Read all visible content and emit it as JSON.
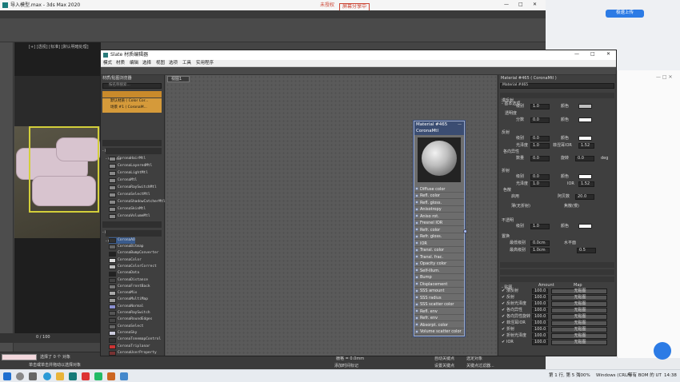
{
  "max": {
    "title": "导入模型.max - 3ds Max 2020",
    "title_center": "未授权",
    "recording": "屏幕分享中",
    "menu": [
      "文件(F)",
      "编辑(E)",
      "工具(T)",
      "组(G)",
      "视图(V)",
      "创建(C)",
      "修改器(M)",
      "动画(A)",
      "图形编辑器(D)",
      "渲染(R)",
      "Civil View",
      "自定义(U)",
      "脚本(S)",
      "Interactive",
      "内容"
    ],
    "search_placeholder": "登录",
    "workspace": "工作区:",
    "view_select": "视图",
    "viewport_label": "[+] [透视] [标准] [默认明暗处理]",
    "time_label": "0 / 100",
    "status_left": "选择了 0 个 对象",
    "status_hint": "单击或单击并拖动以选择对象",
    "coord_x": "X: 0.0mm",
    "coord_y": "Y: 0.0mm",
    "coord_z": "Z: 0.0mm",
    "grid": "栅格 = 0.0mm",
    "auto_key": "自动关键点",
    "set_key": "设置关键点",
    "select_obj": "选定对象",
    "filter": "关键点过滤器...",
    "add_time": "添加时间标记"
  },
  "slate": {
    "title": "Slate 材质编辑器",
    "menu": [
      "模式",
      "材质",
      "编辑",
      "选择",
      "视图",
      "选项",
      "工具",
      "实用程序"
    ],
    "browser_title": "材质/贴图浏览器",
    "browser_search": "按名称搜索...",
    "sample_header": "- 示例窗插槽",
    "view_tab": "视图1",
    "scene_entries": [
      "默认材质 ( Color Cor...",
      "场景 #1 ( CoronaM..."
    ],
    "materials_header": "- Materials",
    "corona_header": "- Corona",
    "materials": [
      "CoronaHairMtl",
      "CoronaLayeredMtl",
      "CoronaLightMtl",
      "CoronaMtl",
      "CoronaRaySwitchMtl",
      "CoronaSelectMtl",
      "CoronaShadowCatcherMtl",
      "CoronaSkinMtl",
      "CoronaVolumeMtl"
    ],
    "maps_header": "- Maps",
    "maps_corona_header": "- Corona",
    "maps": [
      "CoronaAO",
      "CoronaBitmap",
      "CoronaBumpConverter",
      "CoronaColor",
      "CoronaColorCorrect",
      "CoronaData",
      "CoronaDistance",
      "CoronaFrontBack",
      "CoronaMix",
      "CoronaMultiMap",
      "CoronaNormal",
      "CoronaRaySwitch",
      "CoronaRoundEdges",
      "CoronaSelect",
      "CoronaSky",
      "CoronaTonemapControl",
      "CoronaTriplanar",
      "CoronaUserProperty",
      "CoronaWireAndHatch"
    ],
    "status_text": "已完成渲染",
    "zoom": "100%"
  },
  "node": {
    "title": "Material #465",
    "subtitle": "CoronaMtl",
    "slots": [
      "Diffuse color",
      "Refl. color",
      "Refl. gloss.",
      "Anisotropy",
      "Aniso rot.",
      "Fresnel IOR",
      "Refr. color",
      "Refr. gloss.",
      "IOR",
      "Transl. color",
      "Transl. frac.",
      "Opacity color",
      "Self-illum.",
      "Bump",
      "Displacement",
      "SSS amount",
      "SSS radius",
      "SSS scatter color",
      "Refl. env",
      "Refr. env",
      "Absorpt. color",
      "Volume scatter color"
    ]
  },
  "params": {
    "title": "Material #465 ( CoronaMtl )",
    "name_field": "Material #465",
    "basic_header": "- 基本选项",
    "diffuse": {
      "label": "漫反射",
      "level": "级别",
      "level_val": "1.0",
      "color": "颜色",
      "translucency": "透明度",
      "fraction": "分数",
      "fraction_val": "0.0"
    },
    "reflection": {
      "label": "反射",
      "level": "级别",
      "level_val": "0.0",
      "color": "颜色",
      "gloss": "光泽度",
      "gloss_val": "1.0",
      "fresnel": "菲涅耳IOR",
      "fresnel_val": "1.52",
      "aniso": "各向异性",
      "amount": "数量",
      "amount_val": "0.0",
      "rotation": "旋转",
      "rotation_val": "0.0",
      "deg": "deg"
    },
    "refraction": {
      "label": "折射",
      "level": "级别",
      "level_val": "0.0",
      "color": "颜色",
      "gloss": "光泽度",
      "gloss_val": "1.0",
      "ior": "IOR",
      "ior_val": "1.52",
      "dispersion": "色散",
      "enable": "启用",
      "abbe": "阿贝数",
      "abbe_val": "20.0",
      "thin": "薄(无折射)",
      "caustics": "焦散(慢)"
    },
    "opacity": {
      "label": "不透明",
      "level": "级别",
      "level_val": "1.0",
      "color": "颜色"
    },
    "displacement": {
      "label": "置换",
      "min": "最低级别",
      "min_val": "0.0cm",
      "water": "水平面",
      "max": "最高级别",
      "max_val": "1.0cm",
      "waterlevel_val": "0.5"
    },
    "sss_header": "+ 体积和 SSS",
    "advanced_header": "+ 高级选项",
    "maps_header": "- 贴图",
    "maps_cols": [
      "Amount",
      "Map"
    ],
    "maps_rows": [
      {
        "name": "漫反射",
        "amount": "100.0",
        "map": "无贴图"
      },
      {
        "name": "反射",
        "amount": "100.0",
        "map": "无贴图"
      },
      {
        "name": "反射光泽度",
        "amount": "100.0",
        "map": "无贴图"
      },
      {
        "name": "各向异性",
        "amount": "100.0",
        "map": "无贴图"
      },
      {
        "name": "各向异性旋转",
        "amount": "100.0",
        "map": "无贴图"
      },
      {
        "name": "菲涅耳IOR",
        "amount": "100.0",
        "map": "无贴图"
      },
      {
        "name": "折射",
        "amount": "100.0",
        "map": "无贴图"
      },
      {
        "name": "折射光泽度",
        "amount": "100.0",
        "map": "无贴图"
      },
      {
        "name": "IOR",
        "amount": "100.0",
        "map": "无贴图"
      }
    ],
    "zoom": "100%"
  },
  "bg_app": {
    "upload": "极速上传"
  },
  "taskbar": {
    "lang": "第 1 行, 第 5 列",
    "zoom": "100%",
    "eol": "Windows (CRLF)",
    "encoding": "带有 BOM 的 UT",
    "time": "14:38"
  },
  "colors": {
    "accent": "#c98a2b",
    "node_head": "#3b4d72",
    "max_bg": "#444444"
  }
}
